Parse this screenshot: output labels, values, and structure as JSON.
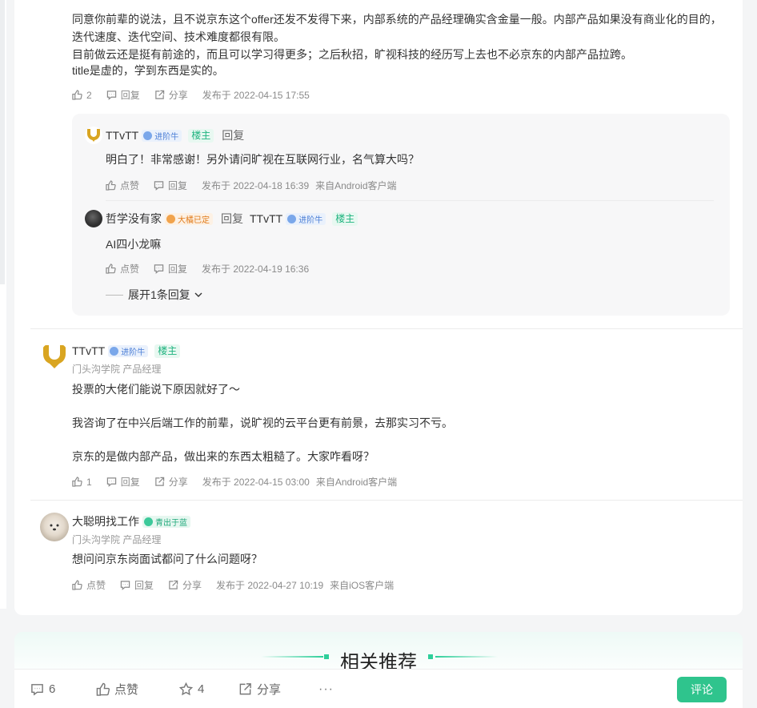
{
  "comment1": {
    "lines": [
      "同意你前辈的说法，且不说京东这个offer还发不发得下来，内部系统的产品经理确实含金量一般。内部产品如果没有商业化的目的，",
      "迭代速度、迭代空间、技术难度都很有限。",
      "目前做云还是挺有前途的，而且可以学习得更多；之后秋招，旷视科技的经历写上去也不必京东的内部产品拉跨。",
      "title是虚的，学到东西是实的。"
    ],
    "likes": "2",
    "reply_label": "回复",
    "share_label": "分享",
    "published": "发布于 2022-04-15 17:55"
  },
  "reply1": {
    "user": "TTvTT",
    "badge": "进阶牛",
    "host_tag": "楼主",
    "reply_word": "回复",
    "text": "明白了！非常感谢！另外请问旷视在互联网行业，名气算大吗？",
    "like_label": "点赞",
    "reply_label": "回复",
    "published": "发布于 2022-04-18 16:39",
    "source": "来自Android客户端"
  },
  "reply2": {
    "user": "哲学没有家",
    "badge": "大橘已定",
    "reply_word": "回复",
    "target_user": "TTvTT",
    "target_badge": "进阶牛",
    "host_tag": "楼主",
    "text": "AI四小龙嘛",
    "like_label": "点赞",
    "reply_label": "回复",
    "published": "发布于 2022-04-19 16:36"
  },
  "expand_label": "展开1条回复",
  "comment2": {
    "user": "TTvTT",
    "badge": "进阶牛",
    "host_tag": "楼主",
    "subtitle": "门头沟学院 产品经理",
    "lines": [
      "投票的大佬们能说下原因就好了～",
      "我咨询了在中兴后端工作的前辈，说旷视的云平台更有前景，去那实习不亏。",
      "京东的是做内部产品，做出来的东西太粗糙了。大家咋看呀？"
    ],
    "likes": "1",
    "reply_label": "回复",
    "share_label": "分享",
    "published": "发布于 2022-04-15 03:00",
    "source": "来自Android客户端"
  },
  "comment3": {
    "user": "大聪明找工作",
    "badge": "青出于蓝",
    "subtitle": "门头沟学院 产品经理",
    "text": "想问问京东岗面试都问了什么问题呀？",
    "like_label": "点赞",
    "reply_label": "回复",
    "share_label": "分享",
    "published": "发布于 2022-04-27 10:19",
    "source": "来自iOS客户端"
  },
  "recommend_title": "相关推荐",
  "bottom_bar": {
    "comments": "6",
    "like_label": "点赞",
    "stars": "4",
    "share_label": "分享",
    "more": "···",
    "comment_button": "评论"
  },
  "colors": {
    "accent_green": "#2fc48d",
    "badge_blue": "#4c7fd6",
    "badge_orange": "#e07a1a"
  }
}
